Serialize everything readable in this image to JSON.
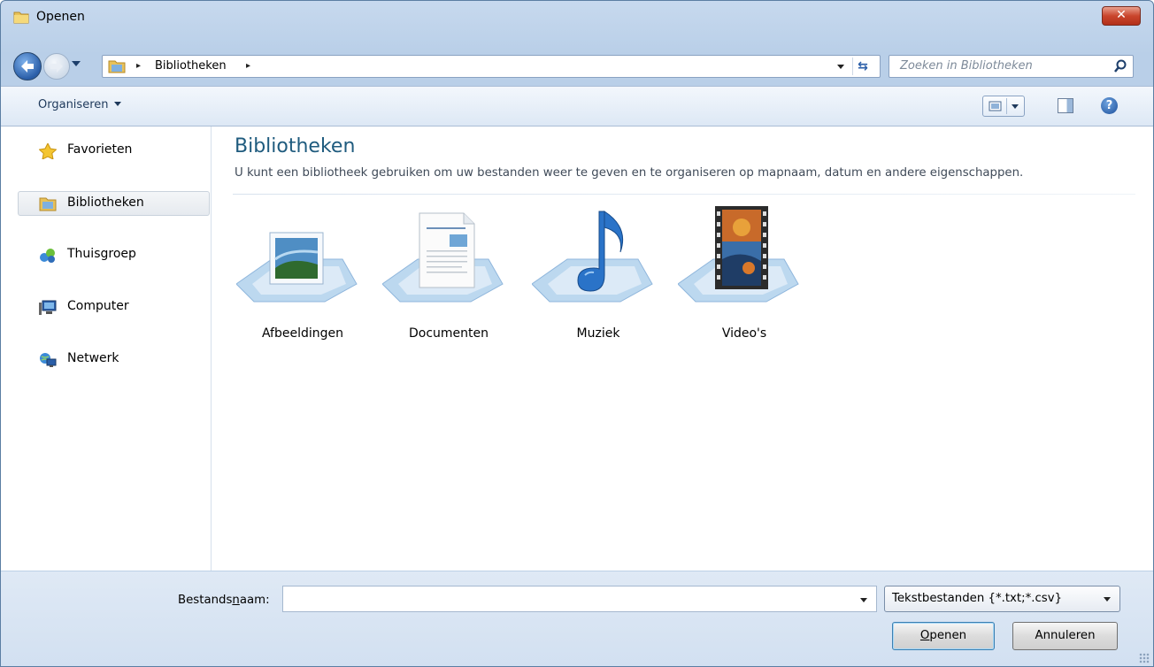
{
  "window": {
    "title": "Openen",
    "close_label": "✕"
  },
  "address": {
    "segment": "Bibliotheken",
    "separator": "▸"
  },
  "search": {
    "placeholder": "Zoeken in Bibliotheken"
  },
  "toolbar": {
    "organize_label": "Organiseren",
    "help_label": "?"
  },
  "sidebar": {
    "items": [
      {
        "label": "Favorieten",
        "icon": "star-icon"
      },
      {
        "label": "Bibliotheken",
        "icon": "library-icon",
        "selected": true
      },
      {
        "label": "Thuisgroep",
        "icon": "homegroup-icon"
      },
      {
        "label": "Computer",
        "icon": "computer-icon"
      },
      {
        "label": "Netwerk",
        "icon": "network-icon"
      }
    ]
  },
  "content": {
    "title": "Bibliotheken",
    "subtitle": "U kunt een bibliotheek gebruiken om uw bestanden weer te geven en te organiseren op mapnaam, datum en andere eigenschappen.",
    "libraries": [
      {
        "label": "Afbeeldingen",
        "icon": "pictures-library-icon"
      },
      {
        "label": "Documenten",
        "icon": "documents-library-icon"
      },
      {
        "label": "Muziek",
        "icon": "music-library-icon"
      },
      {
        "label": "Video's",
        "icon": "videos-library-icon"
      }
    ]
  },
  "footer": {
    "filename_label_pre": "Bestands",
    "filename_label_accel": "n",
    "filename_label_post": "aam:",
    "filename_value": "",
    "filetype_value": "Tekstbestanden {*.txt;*.csv}",
    "open_accel": "O",
    "open_rest": "penen",
    "cancel_label": "Annuleren"
  }
}
